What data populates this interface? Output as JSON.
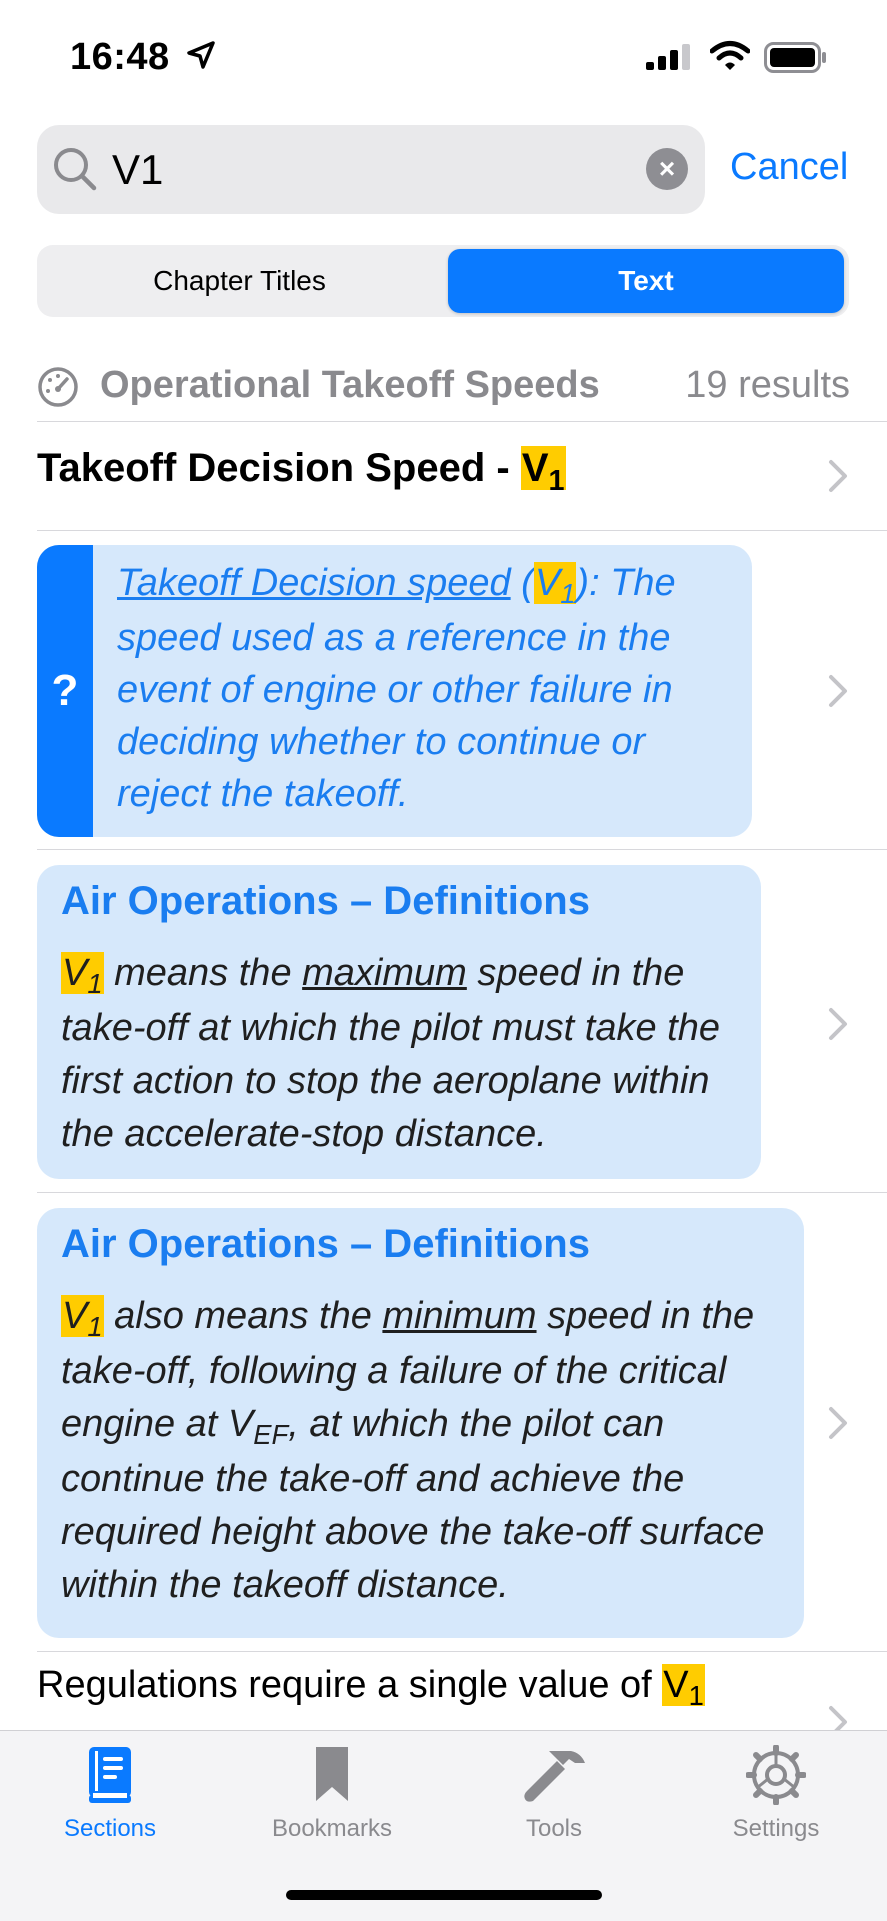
{
  "status": {
    "time": "16:48"
  },
  "search": {
    "value": "V1",
    "cancel_label": "Cancel"
  },
  "segments": {
    "chapter_titles": "Chapter Titles",
    "text": "Text"
  },
  "section": {
    "title": "Operational Takeoff Speeds",
    "count": "19 results"
  },
  "results": {
    "r1": {
      "prefix": "Takeoff Decision Speed - ",
      "v": "V",
      "sub": "1"
    },
    "r2": {
      "mark": "?",
      "link": "Takeoff Decision speed",
      "open": " (",
      "v": "V",
      "sub": "1",
      "rest": "): The speed used as a reference in the event of engine or other failure in deciding whether to continue or reject the takeoff."
    },
    "r3": {
      "heading": "Air Operations – Definitions",
      "v": "V",
      "sub": "1",
      "t1": " means the ",
      "u": "maximum",
      "t2": " speed in the take-off at which the pilot must take the first action to stop the aeroplane within the accelerate-stop distance."
    },
    "r4": {
      "heading": "Air Operations – Definitions",
      "v": "V",
      "sub": "1",
      "t1": " also means the ",
      "u": "minimum",
      "t2": " speed in the take-off, following a failure of the critical engine at V",
      "sub2": "EF",
      "t3": ", at which the pilot can continue the take-off and achieve the required height above the take-off surface within the takeoff distance."
    },
    "r5": {
      "text": "Regulations require a single value of ",
      "v": "V",
      "sub": "1"
    }
  },
  "tabs": [
    {
      "label": "Sections",
      "icon": "book-icon",
      "active": true
    },
    {
      "label": "Bookmarks",
      "icon": "bookmark-icon",
      "active": false
    },
    {
      "label": "Tools",
      "icon": "hammer-icon",
      "active": false
    },
    {
      "label": "Settings",
      "icon": "gear-icon",
      "active": false
    }
  ],
  "colors": {
    "accent": "#0a7aff",
    "highlight": "#ffcc00",
    "card_bg": "#d6e8fb"
  }
}
